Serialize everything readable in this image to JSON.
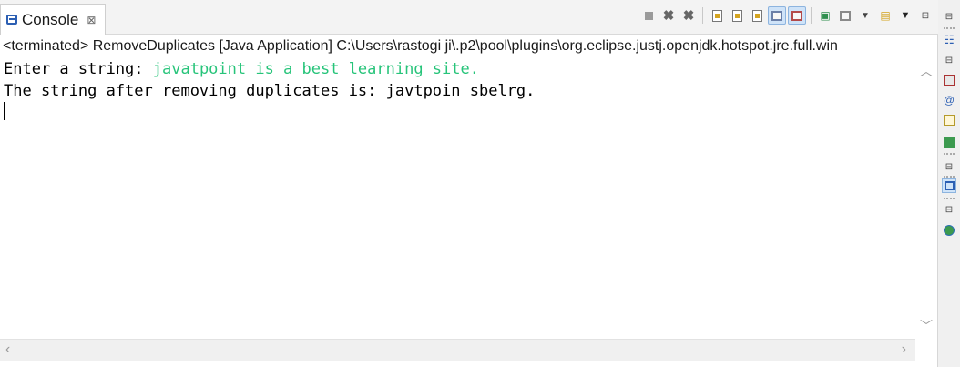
{
  "tab": {
    "label": "Console",
    "close_glyph": "⊠"
  },
  "status_line": "<terminated> RemoveDuplicates [Java Application] C:\\Users\\rastogi ji\\.p2\\pool\\plugins\\org.eclipse.justj.openjdk.hotspot.jre.full.win",
  "console": {
    "line1_prompt": "Enter a string: ",
    "line1_input": "javatpoint is a best learning site.",
    "line2": "The string after removing duplicates is: javtpoin sbelrg."
  },
  "toolbar_icons": [
    "terminate-icon",
    "remove-launch-icon",
    "remove-all-terminated-icon",
    "clear-console-icon",
    "scroll-lock-icon",
    "word-wrap-icon",
    "show-on-stdout-icon",
    "show-on-stderr-icon",
    "pin-console-icon",
    "display-selected-console-icon",
    "view-menu-icon",
    "open-console-icon",
    "view-menu-chevron-icon",
    "minimize-icon"
  ],
  "colors": {
    "input_text": "#27c47a",
    "active_toggle": "#cfe3f8",
    "tab_icon": "#2c5fb3"
  }
}
